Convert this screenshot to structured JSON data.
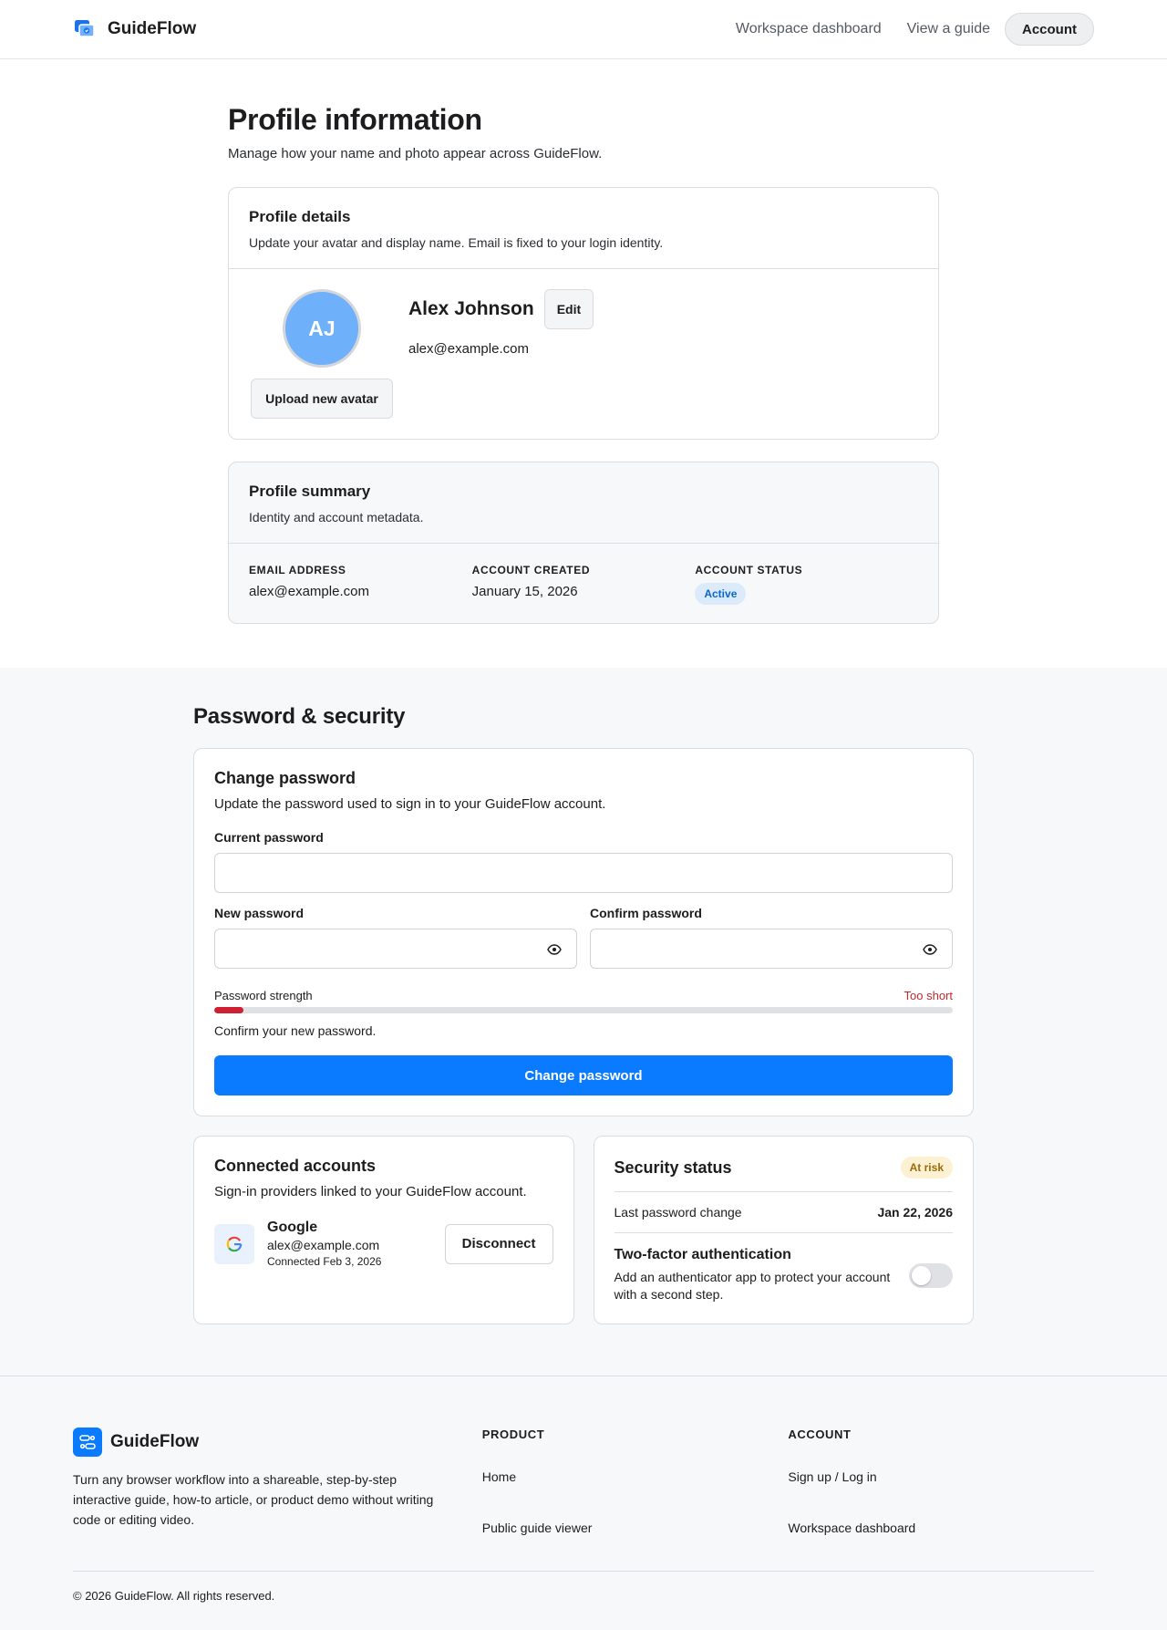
{
  "header": {
    "brand": "GuideFlow",
    "nav": [
      "Workspace dashboard",
      "View a guide"
    ],
    "account_label": "Account"
  },
  "profile": {
    "title": "Profile information",
    "subtitle": "Manage how your name and photo appear across GuideFlow.",
    "details": {
      "title": "Profile details",
      "description": "Update your avatar and display name. Email is fixed to your login identity.",
      "avatar_initials": "AJ",
      "avatar_color": "#6eb0fa",
      "upload_label": "Upload new avatar",
      "display_name": "Alex Johnson",
      "edit_label": "Edit",
      "email": "alex@example.com"
    },
    "summary": {
      "title": "Profile summary",
      "description": "Identity and account metadata.",
      "items": [
        {
          "label": "EMAIL ADDRESS",
          "value": "alex@example.com"
        },
        {
          "label": "ACCOUNT CREATED",
          "value": "January 15, 2026"
        },
        {
          "label": "ACCOUNT STATUS",
          "value": "Active"
        }
      ]
    }
  },
  "security": {
    "title": "Password & security",
    "change_password": {
      "title": "Change password",
      "description": "Update the password used to sign in to your GuideFlow account.",
      "current_label": "Current password",
      "current_value": "",
      "new_label": "New password",
      "new_value": "",
      "confirm_label": "Confirm password",
      "confirm_value": "",
      "strength_label": "Password strength",
      "strength_status": "Too short",
      "strength_fraction": 0.04,
      "strength_color": "#cf1f33",
      "hint": "Confirm your new password.",
      "submit_label": "Change password",
      "accent": "#0a7aff"
    },
    "connected": {
      "title": "Connected accounts",
      "description": "Sign-in providers linked to your GuideFlow account.",
      "provider": {
        "icon": "google-icon",
        "name": "Google",
        "email": "alex@example.com",
        "connected": "Connected Feb 3, 2026",
        "action": "Disconnect"
      }
    },
    "status": {
      "title": "Security status",
      "badge": "At risk",
      "last_change_label": "Last password change",
      "last_change_value": "Jan 22, 2026",
      "tfa_title": "Two-factor authentication",
      "tfa_description": "Add an authenticator app to protect your account with a second step.",
      "tfa_enabled": false
    }
  },
  "footer": {
    "brand": "GuideFlow",
    "tagline": "Turn any browser workflow into a shareable, step-by-step interactive guide, how-to article, or product demo without writing code or editing video.",
    "product_heading": "PRODUCT",
    "product_links": [
      "Home",
      "Public guide viewer"
    ],
    "account_heading": "ACCOUNT",
    "account_links": [
      "Sign up / Log in",
      "Workspace dashboard"
    ],
    "copyright": "© 2026 GuideFlow. All rights reserved."
  }
}
